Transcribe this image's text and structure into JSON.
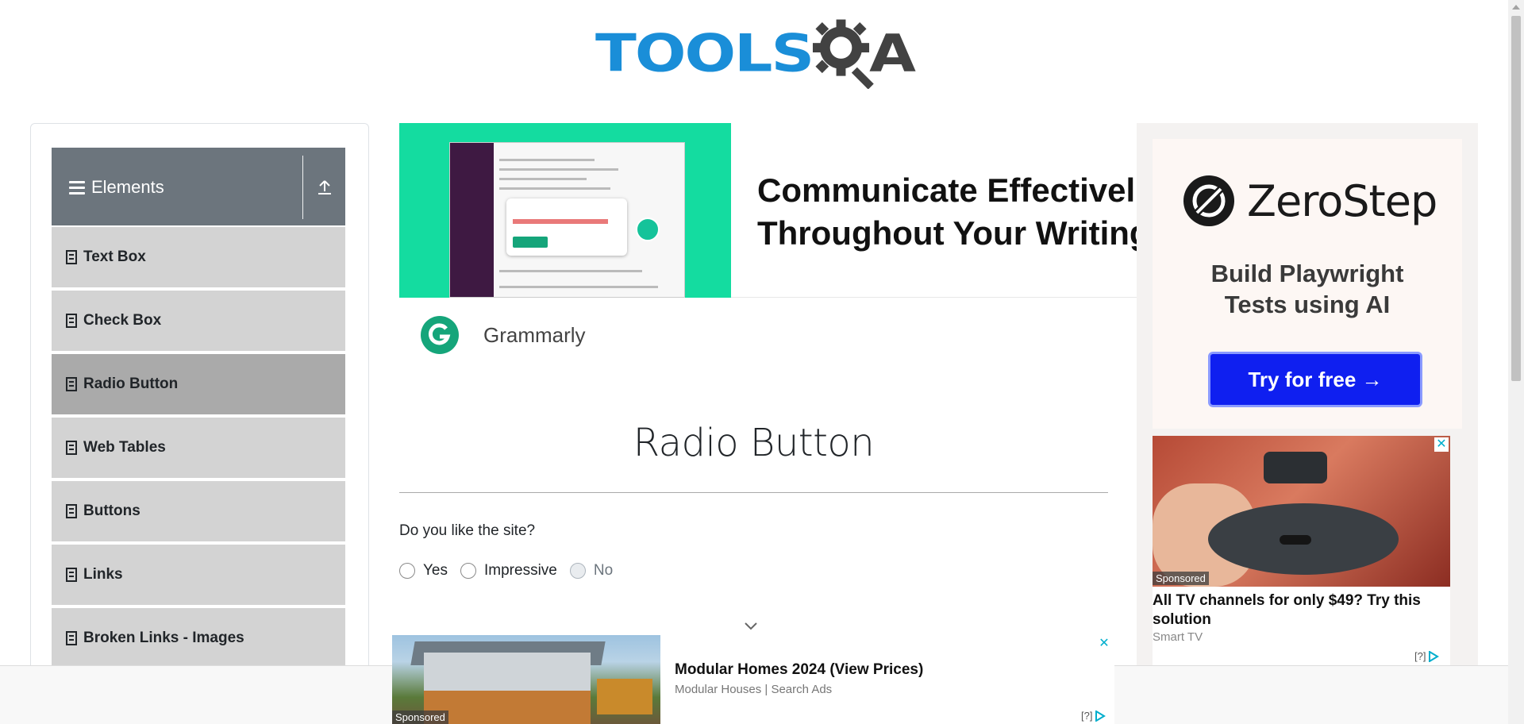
{
  "header": {
    "logo_text": "TOOLS",
    "logo_letter": "A"
  },
  "sidebar": {
    "group_title": "Elements",
    "items": [
      {
        "label": "Text Box",
        "active": false
      },
      {
        "label": "Check Box",
        "active": false
      },
      {
        "label": "Radio Button",
        "active": true
      },
      {
        "label": "Web Tables",
        "active": false
      },
      {
        "label": "Buttons",
        "active": false
      },
      {
        "label": "Links",
        "active": false
      },
      {
        "label": "Broken Links - Images",
        "active": false
      }
    ]
  },
  "ad_banner": {
    "headline_line1": "Communicate Effectivel",
    "headline_line2": "Throughout Your Writing",
    "brand": "Grammarly"
  },
  "main": {
    "page_title": "Radio Button",
    "question": "Do you like the site?",
    "options": [
      {
        "label": "Yes",
        "disabled": false
      },
      {
        "label": "Impressive",
        "disabled": false
      },
      {
        "label": "No",
        "disabled": true
      }
    ]
  },
  "right_ad": {
    "brand": "ZeroStep",
    "tagline_line1": "Build Playwright",
    "tagline_line2": "Tests using AI",
    "cta": "Try for free →"
  },
  "tv_ad": {
    "badge": "Sponsored",
    "headline": "All TV channels for only $49? Try this solution",
    "source": "Smart TV",
    "adchoice": "[?]",
    "close": "✕"
  },
  "bottom_ad": {
    "badge": "Sponsored",
    "headline": "Modular Homes 2024 (View Prices)",
    "source": "Modular Houses | Search Ads",
    "adchoice": "[?]",
    "close": "✕"
  },
  "colors": {
    "logo_blue": "#1a8ed8",
    "logo_dark": "#424242",
    "sidebar_header": "#6c757d",
    "menu_item": "#d3d3d3",
    "menu_item_active": "#aaaaaa",
    "grammarly_green": "#14dca0",
    "zerostep_button": "#0f1ff0"
  }
}
